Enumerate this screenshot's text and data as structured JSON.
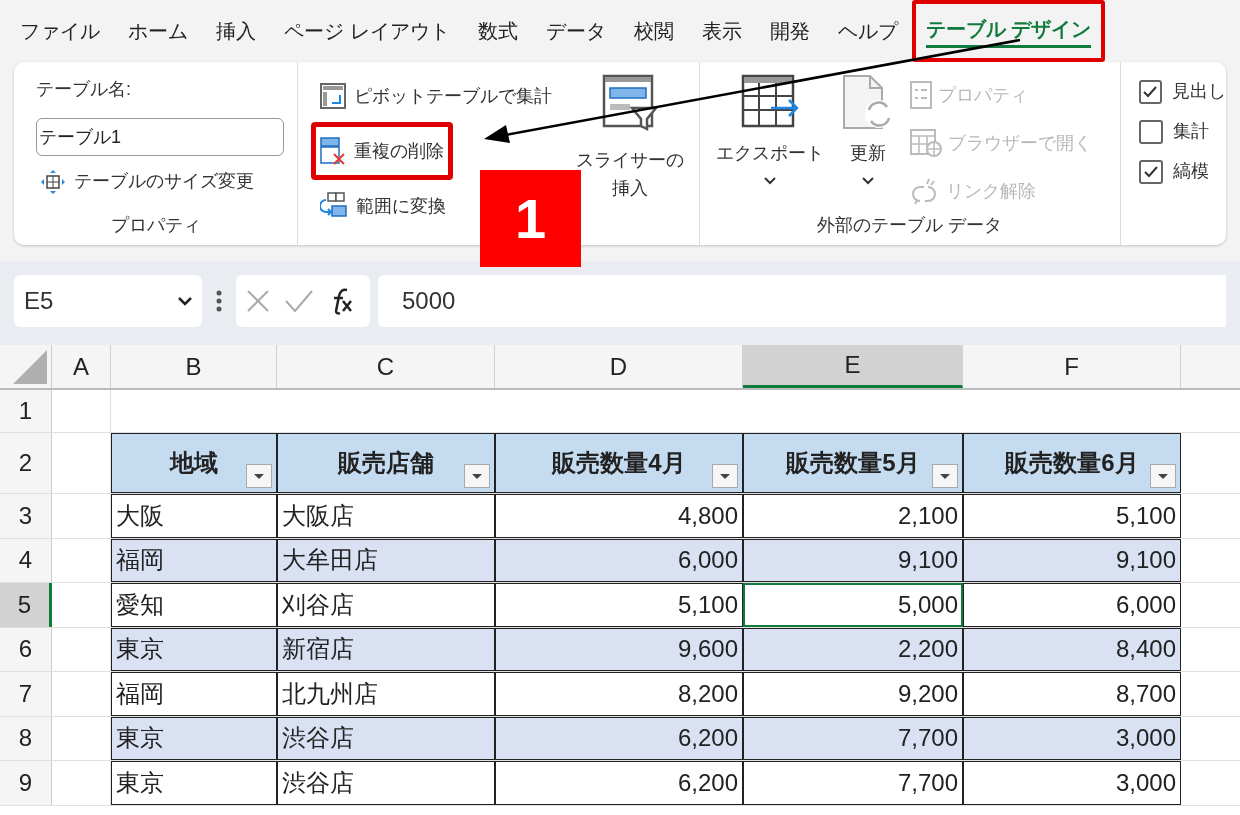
{
  "menu_tabs": [
    {
      "label": "ファイル",
      "selected": false,
      "highlighted": false
    },
    {
      "label": "ホーム",
      "selected": false,
      "highlighted": false
    },
    {
      "label": "挿入",
      "selected": false,
      "highlighted": false
    },
    {
      "label": "ページ レイアウト",
      "selected": false,
      "highlighted": false
    },
    {
      "label": "数式",
      "selected": false,
      "highlighted": false
    },
    {
      "label": "データ",
      "selected": false,
      "highlighted": false
    },
    {
      "label": "校閲",
      "selected": false,
      "highlighted": false
    },
    {
      "label": "表示",
      "selected": false,
      "highlighted": false
    },
    {
      "label": "開発",
      "selected": false,
      "highlighted": false
    },
    {
      "label": "ヘルプ",
      "selected": false,
      "highlighted": false
    },
    {
      "label": "テーブル デザイン",
      "selected": true,
      "highlighted": true
    }
  ],
  "ribbon": {
    "properties_group": {
      "table_name_label": "テーブル名:",
      "table_name": "テーブル1",
      "resize_button": "テーブルのサイズ変更",
      "group_label": "プロパティ"
    },
    "tools_group": {
      "items": [
        {
          "kind": "pivot",
          "label": "ピボットテーブルで集計",
          "highlighted": false
        },
        {
          "kind": "dedupe",
          "label": "重複の削除",
          "highlighted": true
        },
        {
          "kind": "convert",
          "label": "範囲に変換",
          "highlighted": false
        }
      ],
      "slicer_button": [
        "スライサーの",
        "挿入"
      ]
    },
    "external_group": {
      "export_button": "エクスポート",
      "refresh_button": "更新",
      "items": [
        {
          "kind": "properties",
          "label": "プロパティ",
          "disabled": true
        },
        {
          "kind": "browser",
          "label": "ブラウザーで開く",
          "disabled": true
        },
        {
          "kind": "unlink",
          "label": "リンク解除",
          "disabled": true
        }
      ],
      "group_label": "外部のテーブル データ"
    },
    "style_options": [
      {
        "label": "見出し",
        "checked": true
      },
      {
        "label": "集計",
        "checked": false
      },
      {
        "label": "縞模",
        "checked": true
      }
    ]
  },
  "step_badge": "1",
  "formula_bar": {
    "name_box": "E5",
    "formula": "5000"
  },
  "sheet": {
    "columns": [
      {
        "label": "A",
        "selected": false
      },
      {
        "label": "B",
        "selected": false
      },
      {
        "label": "C",
        "selected": false
      },
      {
        "label": "D",
        "selected": false
      },
      {
        "label": "E",
        "selected": true
      },
      {
        "label": "F",
        "selected": false
      }
    ],
    "row_numbers": [
      {
        "label": "1",
        "selected": false
      },
      {
        "label": "2",
        "selected": false
      },
      {
        "label": "3",
        "selected": false
      },
      {
        "label": "4",
        "selected": false
      },
      {
        "label": "5",
        "selected": true
      },
      {
        "label": "6",
        "selected": false
      },
      {
        "label": "7",
        "selected": false
      },
      {
        "label": "8",
        "selected": false
      },
      {
        "label": "9",
        "selected": false
      }
    ],
    "table_headers": [
      "地域",
      "販売店舗",
      "販売数量4月",
      "販売数量5月",
      "販売数量6月"
    ],
    "table_rows": [
      {
        "cells": [
          {
            "text": "大阪",
            "selected": false
          },
          {
            "text": "大阪店",
            "selected": false
          },
          {
            "text": "4,800",
            "selected": false
          },
          {
            "text": "2,100",
            "selected": false
          },
          {
            "text": "5,100",
            "selected": false
          }
        ]
      },
      {
        "cells": [
          {
            "text": "福岡",
            "selected": false
          },
          {
            "text": "大牟田店",
            "selected": false
          },
          {
            "text": "6,000",
            "selected": false
          },
          {
            "text": "9,100",
            "selected": false
          },
          {
            "text": "9,100",
            "selected": false
          }
        ]
      },
      {
        "cells": [
          {
            "text": "愛知",
            "selected": false
          },
          {
            "text": "刈谷店",
            "selected": false
          },
          {
            "text": "5,100",
            "selected": false
          },
          {
            "text": "5,000",
            "selected": true
          },
          {
            "text": "6,000",
            "selected": false
          }
        ]
      },
      {
        "cells": [
          {
            "text": "東京",
            "selected": false
          },
          {
            "text": "新宿店",
            "selected": false
          },
          {
            "text": "9,600",
            "selected": false
          },
          {
            "text": "2,200",
            "selected": false
          },
          {
            "text": "8,400",
            "selected": false
          }
        ]
      },
      {
        "cells": [
          {
            "text": "福岡",
            "selected": false
          },
          {
            "text": "北九州店",
            "selected": false
          },
          {
            "text": "8,200",
            "selected": false
          },
          {
            "text": "9,200",
            "selected": false
          },
          {
            "text": "8,700",
            "selected": false
          }
        ]
      },
      {
        "cells": [
          {
            "text": "東京",
            "selected": false
          },
          {
            "text": "渋谷店",
            "selected": false
          },
          {
            "text": "6,200",
            "selected": false
          },
          {
            "text": "7,700",
            "selected": false
          },
          {
            "text": "3,000",
            "selected": false
          }
        ]
      },
      {
        "cells": [
          {
            "text": "東京",
            "selected": false
          },
          {
            "text": "渋谷店",
            "selected": false
          },
          {
            "text": "6,200",
            "selected": false
          },
          {
            "text": "7,700",
            "selected": false
          },
          {
            "text": "3,000",
            "selected": false
          }
        ]
      }
    ]
  }
}
